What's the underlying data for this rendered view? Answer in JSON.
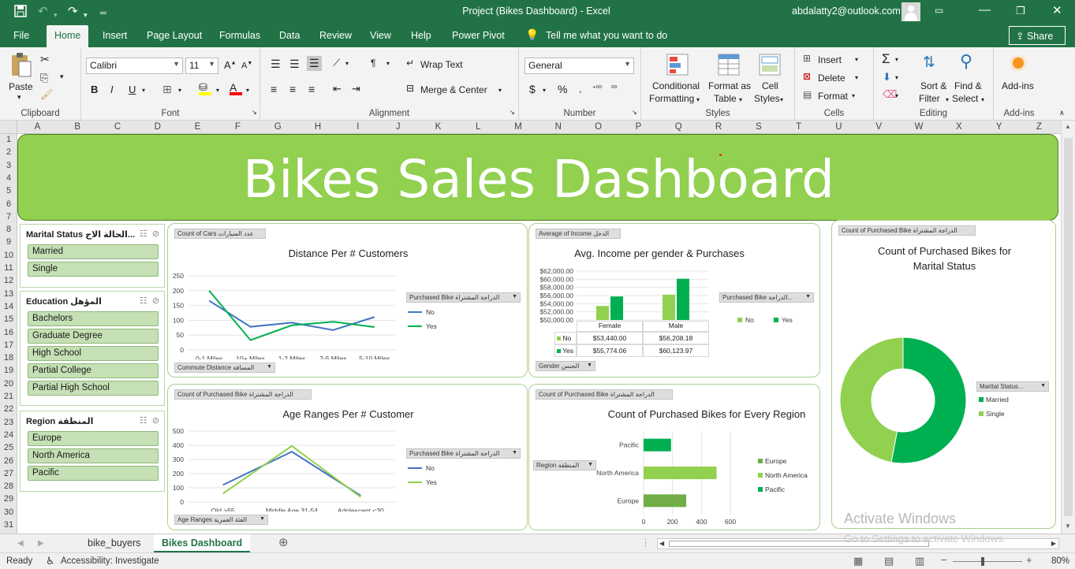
{
  "titlebar": {
    "title": "Project  (Bikes Dashboard)  -  Excel",
    "account": "abdalatty2@outlook.com"
  },
  "menu": {
    "tabs": [
      "File",
      "Home",
      "Insert",
      "Page Layout",
      "Formulas",
      "Data",
      "Review",
      "View",
      "Help",
      "Power Pivot"
    ],
    "active": "Home",
    "tell_me": "Tell me what you want to do",
    "share": "Share"
  },
  "ribbon": {
    "clipboard": {
      "paste": "Paste",
      "label": "Clipboard"
    },
    "font": {
      "name": "Calibri",
      "size": "11",
      "label": "Font"
    },
    "alignment": {
      "wrap_text": "Wrap Text",
      "merge_center": "Merge & Center",
      "label": "Alignment"
    },
    "number": {
      "format": "General",
      "label": "Number"
    },
    "styles": {
      "conditional": [
        "Conditional",
        "Formatting"
      ],
      "format_as": [
        "Format as",
        "Table"
      ],
      "cell": [
        "Cell",
        "Styles"
      ],
      "label": "Styles"
    },
    "cells": {
      "insert": "Insert",
      "delete": "Delete",
      "format": "Format",
      "label": "Cells"
    },
    "editing": {
      "sort": [
        "Sort &",
        "Filter"
      ],
      "find": [
        "Find &",
        "Select"
      ],
      "label": "Editing"
    },
    "addins": {
      "btn": "Add-ins",
      "label": "Add-ins"
    }
  },
  "columns": [
    "A",
    "B",
    "C",
    "D",
    "E",
    "F",
    "G",
    "H",
    "I",
    "J",
    "K",
    "L",
    "M",
    "N",
    "O",
    "P",
    "Q",
    "R",
    "S",
    "T",
    "U",
    "V",
    "W",
    "X",
    "Y",
    "Z"
  ],
  "rows": [
    "1",
    "2",
    "3",
    "4",
    "5",
    "6",
    "7",
    "8",
    "9",
    "10",
    "11",
    "12",
    "13",
    "14",
    "15",
    "16",
    "17",
    "18",
    "19",
    "20",
    "21",
    "22",
    "23",
    "24",
    "25",
    "26",
    "27",
    "28",
    "29",
    "30",
    "31"
  ],
  "dashboard": {
    "title": "Bikes Sales Dashboard",
    "slicers": [
      {
        "header": "Marital Status الحالة الاج...",
        "items": [
          "Married",
          "Single"
        ]
      },
      {
        "header": "Education المؤهل",
        "items": [
          "Bachelors",
          "Graduate Degree",
          "High School",
          "Partial College",
          "Partial High School"
        ]
      },
      {
        "header": "Region المنطقة",
        "items": [
          "Europe",
          "North America",
          "Pacific"
        ]
      }
    ]
  },
  "charts": {
    "distance": {
      "field_value": "Count  of  Cars عدد السيارات",
      "legend_field": "Purchased  Bike الدراجة المشتراة",
      "axis_field": "Commute Distance المسافة"
    },
    "income": {
      "field_value": "Average  of  Income الدخل",
      "legend_field": "Purchased  Bike الدراجة...",
      "axis_field": "Gender الجنس",
      "table": [
        {
          "label": "No",
          "female": "$53,440.00",
          "male": "$56,208.18"
        },
        {
          "label": "Yes",
          "female": "$55,774.06",
          "male": "$60,123.97"
        }
      ]
    },
    "age": {
      "field_value": "Count  of  Purchased  Bike الدراجة المشتراة",
      "legend_field": "Purchased  Bike الدراجة المشتراة",
      "axis_field": "Age  Ranges الفئة العمرية"
    },
    "region": {
      "field_value": "Count  of  Purchased  Bike الدراجة المشتراة",
      "axis_field": "Region المنطقة"
    },
    "marital": {
      "field_value": "Count  of  Purchased  Bike الدراجة المشتراة",
      "legend_field": "Marital Status..."
    }
  },
  "chart_data": [
    {
      "type": "line",
      "title": "Distance Per # Customers",
      "categories": [
        "0-1 Miles",
        "10+ Miles",
        "1-2 Miles",
        "2-5 Miles",
        "5-10 Miles"
      ],
      "series": [
        {
          "name": "No",
          "values": [
            166,
            78,
            92,
            67,
            111
          ],
          "color": "#4472c4"
        },
        {
          "name": "Yes",
          "values": [
            200,
            33,
            83,
            95,
            77
          ],
          "color": "#00b050"
        }
      ],
      "ylim": [
        0,
        250
      ],
      "yticks": [
        0,
        50,
        100,
        150,
        200,
        250
      ],
      "grid": true
    },
    {
      "type": "bar",
      "title": "Avg. Income per gender & Purchases",
      "categories": [
        "Female",
        "Male"
      ],
      "series": [
        {
          "name": "No",
          "values": [
            53440.0,
            56208.18
          ],
          "color": "#92d050"
        },
        {
          "name": "Yes",
          "values": [
            55774.06,
            60123.97
          ],
          "color": "#00b050"
        }
      ],
      "ylim": [
        50000,
        62000
      ],
      "yticks": [
        "$50,000.00",
        "$52,000.00",
        "$54,000.00",
        "$56,000.00",
        "$58,000.00",
        "$60,000.00",
        "$62,000.00"
      ],
      "grid": true
    },
    {
      "type": "line",
      "title": "Age Ranges Per # Customer",
      "categories": [
        "Old  >55",
        "Middle Age  31-54",
        "Adolescent  <30"
      ],
      "series": [
        {
          "name": "No",
          "values": [
            120,
            355,
            45
          ],
          "color": "#4472c4"
        },
        {
          "name": "Yes",
          "values": [
            60,
            395,
            35
          ],
          "color": "#92d050"
        }
      ],
      "ylim": [
        0,
        500
      ],
      "yticks": [
        0,
        100,
        200,
        300,
        400,
        500
      ],
      "grid": true
    },
    {
      "type": "bar",
      "orientation": "horizontal",
      "title": "Count of Purchased Bikes for Every Region",
      "categories": [
        "Pacific",
        "North America",
        "Europe"
      ],
      "values": [
        190,
        505,
        295
      ],
      "series_names": [
        "Europe",
        "North America",
        "Pacific"
      ],
      "colors": [
        "#70ad47",
        "#92d050",
        "#00b050"
      ],
      "xlim": [
        0,
        600
      ],
      "xticks": [
        0,
        200,
        400,
        600
      ],
      "grid": true
    },
    {
      "type": "pie",
      "donut": true,
      "title": "Count of Purchased Bikes for Marital Status",
      "categories": [
        "Married",
        "Single"
      ],
      "values": [
        53,
        47
      ],
      "colors": [
        "#00b050",
        "#92d050"
      ]
    }
  ],
  "sheets": {
    "tabs": [
      "bike_buyers",
      "Bikes Dashboard"
    ],
    "active": "Bikes Dashboard"
  },
  "status": {
    "ready": "Ready",
    "accessibility": "Accessibility: Investigate",
    "zoom": "80%",
    "activate1": "Activate Windows",
    "activate2": "Go to Settings to activate Windows."
  }
}
